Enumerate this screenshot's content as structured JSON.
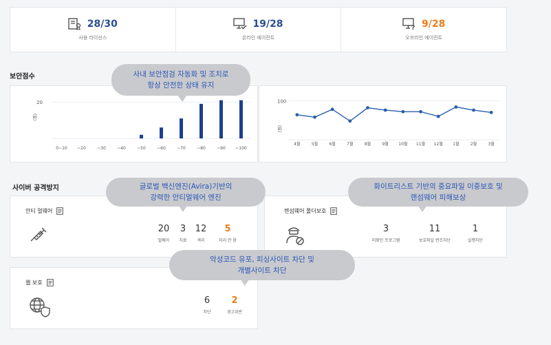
{
  "stats": [
    {
      "value": "28/30",
      "label": "사용 라이선스",
      "icon": "license-icon",
      "color": "#2a4d8f"
    },
    {
      "value": "19/28",
      "label": "온라인 에이전트",
      "icon": "online-monitor-icon",
      "color": "#2a4d8f"
    },
    {
      "value": "9/28",
      "label": "오프라인 에이전트",
      "icon": "offline-monitor-icon",
      "color": "#ef7d1a"
    }
  ],
  "security_score": {
    "title": "보안점수",
    "bubble": [
      "사내 보안점검 자동화 및 조치로",
      "항상 안전한 상태 유지"
    ]
  },
  "chart_data": [
    {
      "type": "bar",
      "ylabel": "(점)",
      "yticks": [
        20
      ],
      "categories": [
        "0~10",
        "~20",
        "~30",
        "~40",
        "~50",
        "~60",
        "~70",
        "~80",
        "~90",
        "~100"
      ],
      "values": [
        0,
        0,
        0,
        0,
        2,
        6,
        11,
        19,
        21,
        21
      ],
      "ylim": [
        0,
        25
      ],
      "grid": true,
      "color": "#1c3f91"
    },
    {
      "type": "line",
      "ylabel": "(점)",
      "yticks": [
        100
      ],
      "categories": [
        "4월",
        "5월",
        "6월",
        "7월",
        "8월",
        "9월",
        "10월",
        "11월",
        "12월",
        "1월",
        "2월",
        "3월"
      ],
      "values": [
        82,
        79,
        89,
        74,
        91,
        88,
        86,
        86,
        80,
        92,
        88,
        85
      ],
      "ylim": [
        50,
        110
      ],
      "grid": true,
      "color": "#2a5fad"
    }
  ],
  "cyber": {
    "title": "사이버 공격방지",
    "bubble_engine": [
      "글로벌 백신엔진(Avira)기반의",
      "강력한 안티멀웨어 엔진"
    ],
    "bubble_whitelist": [
      "화이트리스트 기반의 중요파일 이중보호 및",
      "랜섬웨어 피해보상"
    ],
    "bubble_web": [
      "악성코드 유포, 피싱사이트 차단 및",
      "개별사이트 차단"
    ],
    "antimalware": {
      "title": "안티 멀웨어",
      "metrics": [
        {
          "value": "20",
          "label": "멀웨어"
        },
        {
          "value": "3",
          "label": "치료"
        },
        {
          "value": "12",
          "label": "격리"
        },
        {
          "value": "5",
          "label": "처리 안 함",
          "highlight": true
        }
      ]
    },
    "ransomware": {
      "title": "랜섬웨어 폴더보호",
      "metrics": [
        {
          "value": "3",
          "label": "미확인 프로그램"
        },
        {
          "value": "11",
          "label": "보호파일 변조차단"
        },
        {
          "value": "1",
          "label": "실행차단"
        }
      ]
    },
    "web": {
      "title": "웹 보호",
      "metrics": [
        {
          "value": "6",
          "label": "차단"
        },
        {
          "value": "2",
          "label": "경고위반",
          "highlight": true
        }
      ]
    }
  }
}
